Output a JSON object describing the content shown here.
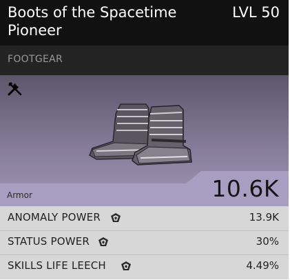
{
  "item": {
    "name_line1": "Boots of the Spacetime",
    "name_line2": "Pioneer",
    "level": "LVL 50",
    "category": "FOOTGEAR"
  },
  "armor": {
    "label": "Armor",
    "value": "10.6K"
  },
  "stats": [
    {
      "name": "ANOMALY POWER",
      "value": "13.9K",
      "icon": "anomaly-gem-icon"
    },
    {
      "name": "STATUS POWER",
      "value": "30%",
      "icon": "anomaly-gem-icon"
    },
    {
      "name": "SKILLS LIFE LEECH",
      "value": "4.49%",
      "icon": "anomaly-gem-icon"
    }
  ],
  "icons": {
    "craft": "tools-icon",
    "item_image": "boots-icon"
  },
  "colors": {
    "header_bg": "#111111",
    "art_bg_top": "#5d566b",
    "art_bg_bottom": "#a197b4",
    "stats_bg": "#d7d7d7"
  }
}
